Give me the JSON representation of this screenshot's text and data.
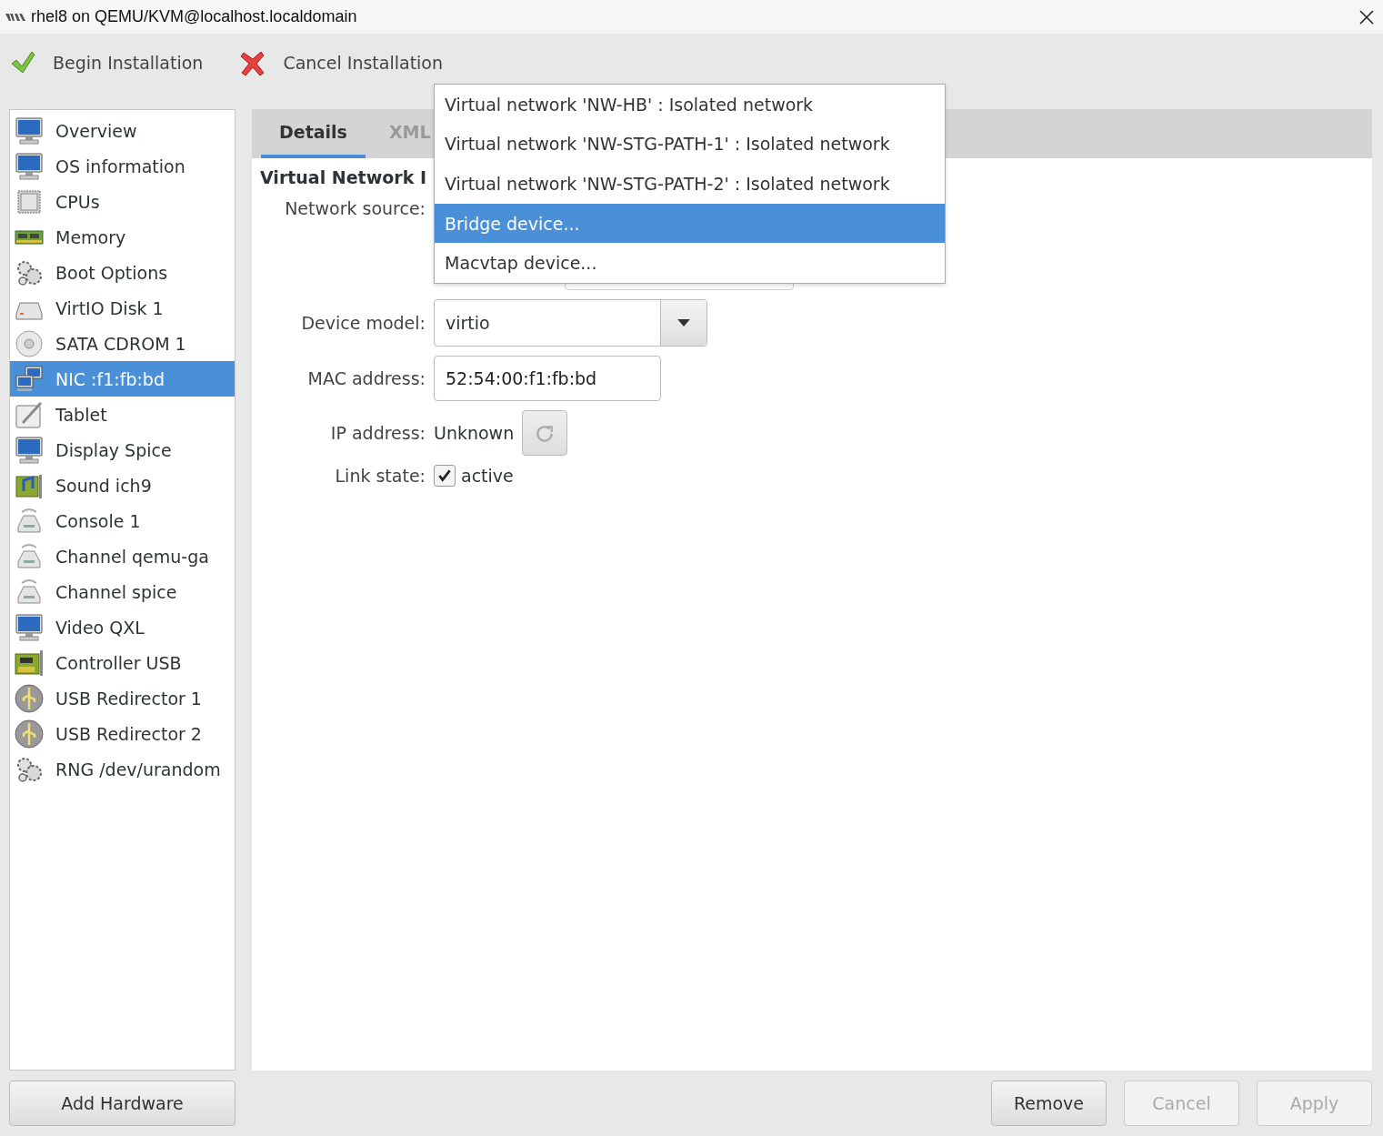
{
  "window": {
    "title": "rhel8 on QEMU/KVM@localhost.localdomain"
  },
  "toolbar": [
    {
      "label": "Begin Installation",
      "kind": "check"
    },
    {
      "label": "Cancel Installation",
      "kind": "cross"
    }
  ],
  "sidebar": {
    "items": [
      {
        "label": "Overview",
        "kind": "monitor",
        "selected": false
      },
      {
        "label": "OS information",
        "kind": "monitor",
        "selected": false
      },
      {
        "label": "CPUs",
        "kind": "chip",
        "selected": false
      },
      {
        "label": "Memory",
        "kind": "memory",
        "selected": false
      },
      {
        "label": "Boot Options",
        "kind": "gears",
        "selected": false
      },
      {
        "label": "VirtIO Disk 1",
        "kind": "disk",
        "selected": false
      },
      {
        "label": "SATA CDROM 1",
        "kind": "cdrom",
        "selected": false
      },
      {
        "label": "NIC :f1:fb:bd",
        "kind": "network",
        "selected": true
      },
      {
        "label": "Tablet",
        "kind": "tablet",
        "selected": false
      },
      {
        "label": "Display Spice",
        "kind": "monitor",
        "selected": false
      },
      {
        "label": "Sound ich9",
        "kind": "sound",
        "selected": false
      },
      {
        "label": "Console 1",
        "kind": "serial",
        "selected": false
      },
      {
        "label": "Channel qemu-ga",
        "kind": "serial",
        "selected": false
      },
      {
        "label": "Channel spice",
        "kind": "serial",
        "selected": false
      },
      {
        "label": "Video QXL",
        "kind": "monitor",
        "selected": false
      },
      {
        "label": "Controller USB",
        "kind": "card",
        "selected": false
      },
      {
        "label": "USB Redirector 1",
        "kind": "usb",
        "selected": false
      },
      {
        "label": "USB Redirector 2",
        "kind": "usb",
        "selected": false
      },
      {
        "label": "RNG /dev/urandom",
        "kind": "gears",
        "selected": false
      }
    ],
    "add_button": "Add Hardware"
  },
  "tabs": [
    {
      "label": "Details",
      "selected": true
    },
    {
      "label": "XML",
      "selected": false
    }
  ],
  "details": {
    "heading": "Virtual Network I",
    "network_source_label": "Network source:",
    "device_model": {
      "label": "Device model:",
      "value": "virtio"
    },
    "mac_address": {
      "label": "MAC address:",
      "value": "52:54:00:f1:fb:bd"
    },
    "ip_address": {
      "label": "IP address:",
      "value": "Unknown"
    },
    "link_state": {
      "label": "Link state:",
      "option": "active",
      "checked": true
    }
  },
  "network_source_menu": [
    {
      "label": "Virtual network 'NW-HB' : Isolated network",
      "selected": false
    },
    {
      "label": "Virtual network 'NW-STG-PATH-1' : Isolated network",
      "selected": false
    },
    {
      "label": "Virtual network 'NW-STG-PATH-2' : Isolated network",
      "selected": false
    },
    {
      "label": "Bridge device...",
      "selected": true
    },
    {
      "label": "Macvtap device...",
      "selected": false
    }
  ],
  "buttons": [
    {
      "label": "Remove",
      "disabled": false
    },
    {
      "label": "Cancel",
      "disabled": true
    },
    {
      "label": "Apply",
      "disabled": true
    }
  ]
}
